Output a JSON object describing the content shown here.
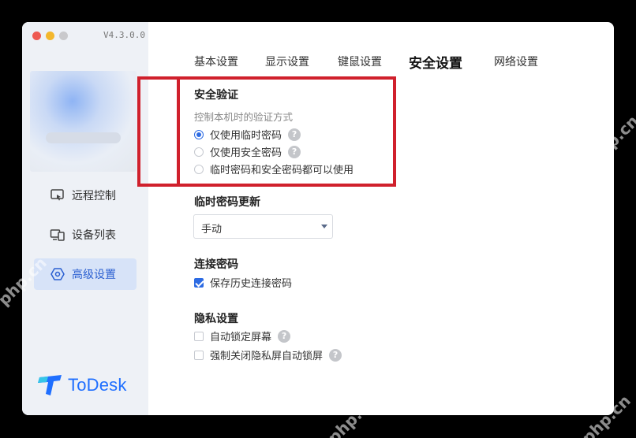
{
  "app": {
    "version": "V4.3.0.0",
    "logo_text": "ToDesk"
  },
  "sidebar": {
    "items": [
      {
        "label": "远程控制",
        "icon": "remote-control-icon",
        "active": false
      },
      {
        "label": "设备列表",
        "icon": "device-list-icon",
        "active": false
      },
      {
        "label": "高级设置",
        "icon": "advanced-settings-icon",
        "active": true
      }
    ]
  },
  "tabs": [
    {
      "label": "基本设置",
      "active": false
    },
    {
      "label": "显示设置",
      "active": false
    },
    {
      "label": "键鼠设置",
      "active": false
    },
    {
      "label": "安全设置",
      "active": true
    },
    {
      "label": "网络设置",
      "active": false
    }
  ],
  "security_verify": {
    "title": "安全验证",
    "subtitle": "控制本机时的验证方式",
    "options": [
      {
        "label": "仅使用临时密码",
        "selected": true,
        "help": "?"
      },
      {
        "label": "仅使用安全密码",
        "selected": false,
        "help": "?"
      },
      {
        "label": "临时密码和安全密码都可以使用",
        "selected": false
      }
    ]
  },
  "temp_password_update": {
    "title": "临时密码更新",
    "selected": "手动"
  },
  "connection_password": {
    "title": "连接密码",
    "checkbox_label": "保存历史连接密码",
    "checked": true
  },
  "privacy": {
    "title": "隐私设置",
    "options": [
      {
        "label": "自动锁定屏幕",
        "checked": false,
        "help": "?"
      },
      {
        "label": "强制关闭隐私屏自动锁屏",
        "checked": false,
        "help": "?"
      }
    ]
  },
  "watermark": "php.cn",
  "colors": {
    "accent": "#2d6be3",
    "highlight_frame": "#d0202c",
    "sidebar_bg": "#eef1f6",
    "active_nav_bg": "#d7e3f8"
  }
}
